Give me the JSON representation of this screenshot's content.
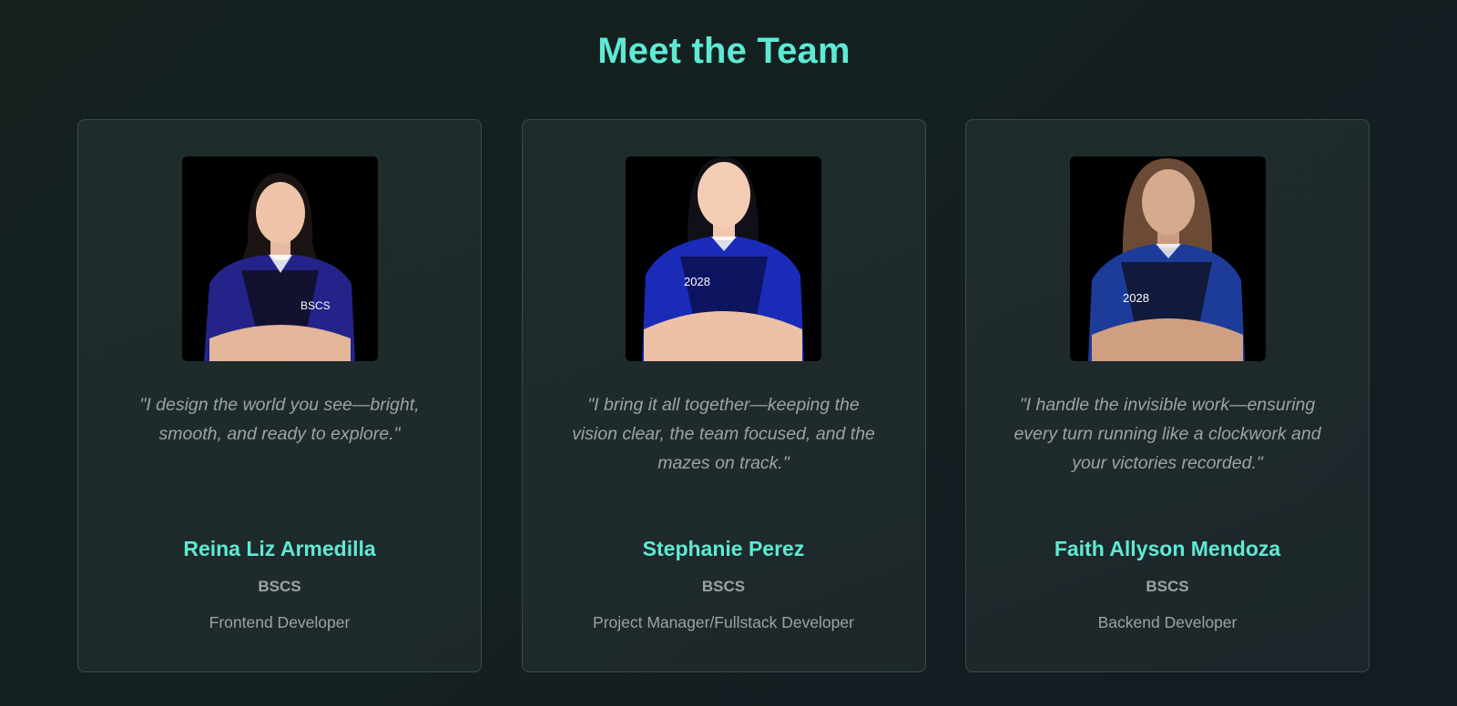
{
  "page": {
    "title": "Meet the Team"
  },
  "team": [
    {
      "quote": "\"I design the world you see—bright, smooth, and ready to explore.\"",
      "name": "Reina Liz Armedilla",
      "program": "BSCS",
      "role": "Frontend Developer",
      "photo_icon": "member-photo",
      "hair_color": "#1a1412",
      "shirt_color": "#23238a"
    },
    {
      "quote": "\"I bring it all together—keeping the vision clear, the team focused, and the mazes on track.\"",
      "name": "Stephanie Perez",
      "program": "BSCS",
      "role": "Project Manager/Fullstack Developer",
      "photo_icon": "member-photo",
      "hair_color": "#111018",
      "shirt_color": "#1a2bb8"
    },
    {
      "quote": "\"I handle the invisible work—ensuring every turn running like a clockwork and your victories recorded.\"",
      "name": "Faith Allyson Mendoza",
      "program": "BSCS",
      "role": "Backend Developer",
      "photo_icon": "member-photo",
      "hair_color": "#6b4a36",
      "shirt_color": "#1d3c9a"
    }
  ],
  "colors": {
    "accent": "#5eead4",
    "muted_text": "#9ca3a6",
    "card_border": "#3a4a4b"
  }
}
